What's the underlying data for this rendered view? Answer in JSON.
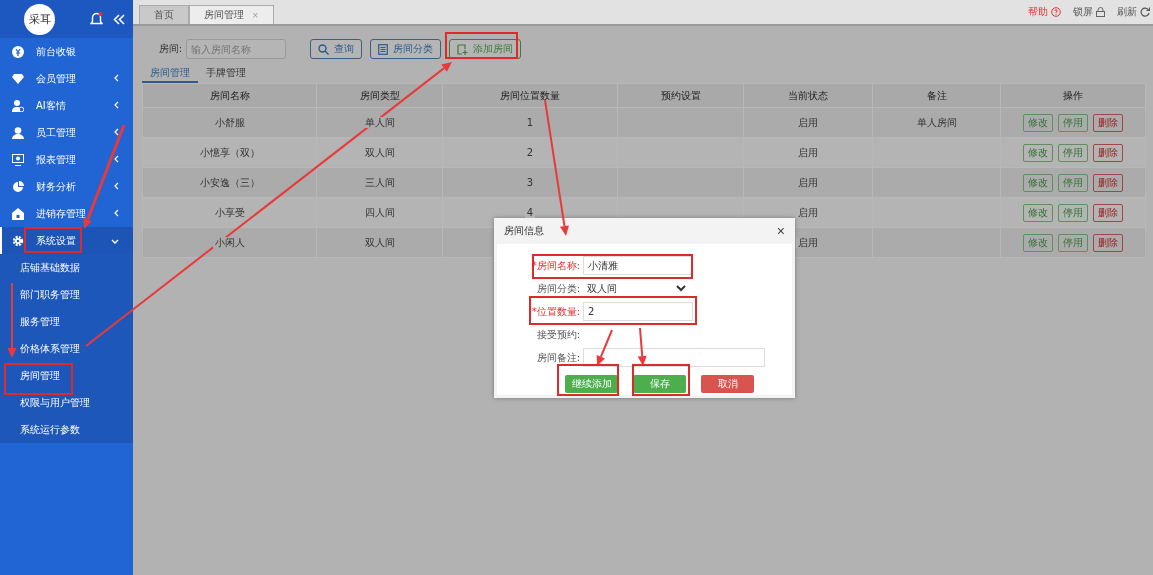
{
  "sidebar": {
    "logo": "采耳",
    "items": [
      {
        "label": "前台收银",
        "kind": "link"
      },
      {
        "label": "会员管理",
        "kind": "group",
        "expanded": false
      },
      {
        "label": "AI客情",
        "kind": "group",
        "expanded": false
      },
      {
        "label": "员工管理",
        "kind": "group",
        "expanded": false
      },
      {
        "label": "报表管理",
        "kind": "group",
        "expanded": false
      },
      {
        "label": "财务分析",
        "kind": "group",
        "expanded": false
      },
      {
        "label": "进销存管理",
        "kind": "group",
        "expanded": false
      },
      {
        "label": "系统设置",
        "kind": "group",
        "expanded": true,
        "children": [
          {
            "label": "店铺基础数据"
          },
          {
            "label": "部门职务管理"
          },
          {
            "label": "服务管理"
          },
          {
            "label": "价格体系管理"
          },
          {
            "label": "房间管理"
          },
          {
            "label": "权限与用户管理"
          },
          {
            "label": "系统运行参数"
          }
        ]
      }
    ]
  },
  "page_tabs": [
    {
      "label": "首页",
      "selected": false
    },
    {
      "label": "房间管理",
      "selected": true,
      "close": "×"
    }
  ],
  "top_links": [
    {
      "label": "帮助",
      "kind": "help"
    },
    {
      "label": "锁屏",
      "kind": "lock"
    },
    {
      "label": "刷新",
      "kind": "refresh"
    }
  ],
  "search": {
    "label": "房间:",
    "placeholder": "输入房间名称"
  },
  "toolbar": [
    {
      "label": "查询",
      "kind": "search"
    },
    {
      "label": "房间分类",
      "kind": "list"
    },
    {
      "label": "添加房间",
      "kind": "add"
    }
  ],
  "sub_tabs": [
    {
      "label": "房间管理",
      "selected": true
    },
    {
      "label": "手牌管理",
      "selected": false
    }
  ],
  "table": {
    "columns": [
      "房间名称",
      "房间类型",
      "房间位置数量",
      "预约设置",
      "当前状态",
      "备注",
      "操作"
    ],
    "rows": [
      {
        "cells": [
          "小舒服",
          "单人间",
          "1",
          "",
          "启用",
          "单人房间"
        ],
        "actions": [
          "修改",
          "停用",
          "删除"
        ]
      },
      {
        "cells": [
          "小憶享（双）",
          "双人间",
          "2",
          "",
          "启用",
          ""
        ],
        "actions": [
          "修改",
          "停用",
          "删除"
        ]
      },
      {
        "cells": [
          "小安逸（三）",
          "三人间",
          "3",
          "",
          "启用",
          ""
        ],
        "actions": [
          "修改",
          "停用",
          "删除"
        ]
      },
      {
        "cells": [
          "小享受",
          "四人间",
          "4",
          "",
          "启用",
          ""
        ],
        "actions": [
          "修改",
          "停用",
          "删除"
        ]
      },
      {
        "cells": [
          "小闲人",
          "双人间",
          "",
          "",
          "启用",
          ""
        ],
        "actions": [
          "修改",
          "停用",
          "删除"
        ]
      }
    ]
  },
  "dialog": {
    "title": "房间信息",
    "close": "×",
    "fields": [
      {
        "label": "*房间名称:",
        "kind": "input",
        "required": true,
        "value": "小清雅"
      },
      {
        "label": "房间分类:",
        "kind": "select",
        "required": false,
        "value": "双人间"
      },
      {
        "label": "*位置数量:",
        "kind": "input",
        "required": true,
        "value": "2"
      },
      {
        "label": "接受预约:",
        "kind": "none",
        "required": false
      },
      {
        "label": "房间备注:",
        "kind": "input",
        "required": false
      }
    ],
    "buttons": [
      {
        "label": "继续添加",
        "kind": "primary"
      },
      {
        "label": "保存",
        "kind": "primary"
      },
      {
        "label": "取消",
        "kind": "danger"
      }
    ]
  },
  "annotations": [
    {
      "kind": "arrow"
    },
    {
      "kind": "arrow"
    },
    {
      "kind": "arrow"
    },
    {
      "kind": "arrow"
    },
    {
      "kind": "arrow"
    },
    {
      "kind": "arrow"
    },
    {
      "kind": "frame"
    },
    {
      "kind": "frame"
    },
    {
      "kind": "frame"
    },
    {
      "kind": "frame"
    },
    {
      "kind": "frame"
    },
    {
      "kind": "frame"
    },
    {
      "kind": "frame"
    }
  ]
}
